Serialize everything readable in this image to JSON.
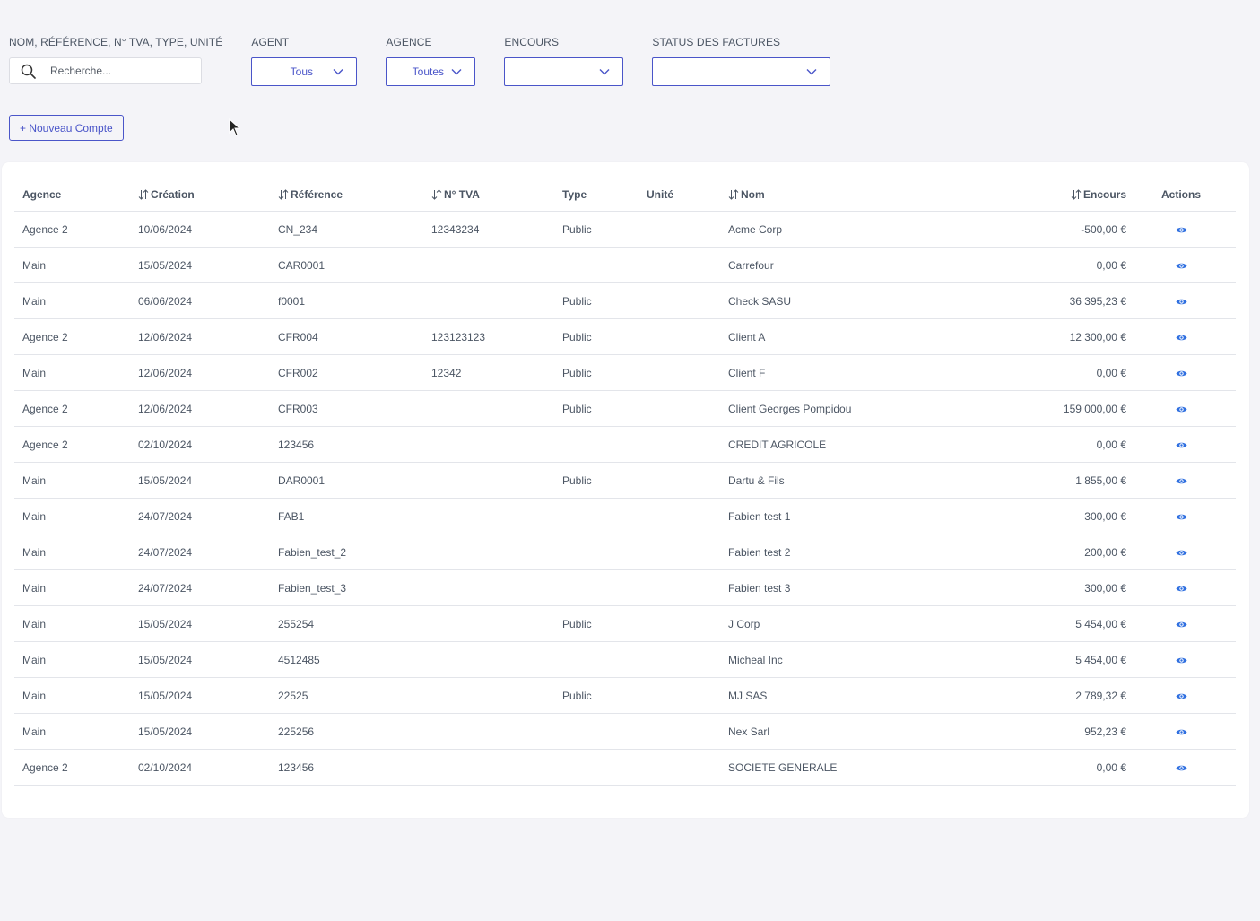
{
  "filters": {
    "search": {
      "label": "NOM, RÉFÉRENCE, N° TVA, TYPE, UNITÉ",
      "placeholder": "Recherche...",
      "value": "",
      "icon": "search-icon"
    },
    "agent": {
      "label": "AGENT",
      "value": "Tous"
    },
    "agence": {
      "label": "AGENCE",
      "value": "Toutes"
    },
    "encours": {
      "label": "ENCOURS",
      "value": ""
    },
    "status": {
      "label": "STATUS DES FACTURES",
      "value": ""
    }
  },
  "new_account_button": {
    "label": "+ Nouveau Compte"
  },
  "table": {
    "columns": {
      "agence": "Agence",
      "creation": "Création",
      "reference": "Référence",
      "tva": "N° TVA",
      "type": "Type",
      "unite": "Unité",
      "nom": "Nom",
      "encours": "Encours",
      "actions": "Actions"
    },
    "rows": [
      {
        "agence": "Agence 2",
        "creation": "10/06/2024",
        "reference": "CN_234",
        "tva": "12343234",
        "type": "Public",
        "unite": "",
        "nom": "Acme Corp",
        "encours": "-500,00 €"
      },
      {
        "agence": "Main",
        "creation": "15/05/2024",
        "reference": "CAR0001",
        "tva": "",
        "type": "",
        "unite": "",
        "nom": "Carrefour",
        "encours": "0,00 €"
      },
      {
        "agence": "Main",
        "creation": "06/06/2024",
        "reference": "f0001",
        "tva": "",
        "type": "Public",
        "unite": "",
        "nom": "Check SASU",
        "encours": "36 395,23 €"
      },
      {
        "agence": "Agence 2",
        "creation": "12/06/2024",
        "reference": "CFR004",
        "tva": "123123123",
        "type": "Public",
        "unite": "",
        "nom": "Client A",
        "encours": "12 300,00 €"
      },
      {
        "agence": "Main",
        "creation": "12/06/2024",
        "reference": "CFR002",
        "tva": "12342",
        "type": "Public",
        "unite": "",
        "nom": "Client F",
        "encours": "0,00 €"
      },
      {
        "agence": "Agence 2",
        "creation": "12/06/2024",
        "reference": "CFR003",
        "tva": "",
        "type": "Public",
        "unite": "",
        "nom": "Client Georges Pompidou",
        "encours": "159 000,00 €"
      },
      {
        "agence": "Agence 2",
        "creation": "02/10/2024",
        "reference": "123456",
        "tva": "",
        "type": "",
        "unite": "",
        "nom": "CREDIT AGRICOLE",
        "encours": "0,00 €"
      },
      {
        "agence": "Main",
        "creation": "15/05/2024",
        "reference": "DAR0001",
        "tva": "",
        "type": "Public",
        "unite": "",
        "nom": "Dartu & Fils",
        "encours": "1 855,00 €"
      },
      {
        "agence": "Main",
        "creation": "24/07/2024",
        "reference": "FAB1",
        "tva": "",
        "type": "",
        "unite": "",
        "nom": "Fabien test 1",
        "encours": "300,00 €"
      },
      {
        "agence": "Main",
        "creation": "24/07/2024",
        "reference": "Fabien_test_2",
        "tva": "",
        "type": "",
        "unite": "",
        "nom": "Fabien test 2",
        "encours": "200,00 €"
      },
      {
        "agence": "Main",
        "creation": "24/07/2024",
        "reference": "Fabien_test_3",
        "tva": "",
        "type": "",
        "unite": "",
        "nom": "Fabien test 3",
        "encours": "300,00 €"
      },
      {
        "agence": "Main",
        "creation": "15/05/2024",
        "reference": "255254",
        "tva": "",
        "type": "Public",
        "unite": "",
        "nom": "J Corp",
        "encours": "5 454,00 €"
      },
      {
        "agence": "Main",
        "creation": "15/05/2024",
        "reference": "4512485",
        "tva": "",
        "type": "",
        "unite": "",
        "nom": "Micheal Inc",
        "encours": "5 454,00 €"
      },
      {
        "agence": "Main",
        "creation": "15/05/2024",
        "reference": "22525",
        "tva": "",
        "type": "Public",
        "unite": "",
        "nom": "MJ SAS",
        "encours": "2 789,32 €"
      },
      {
        "agence": "Main",
        "creation": "15/05/2024",
        "reference": "225256",
        "tva": "",
        "type": "",
        "unite": "",
        "nom": "Nex Sarl",
        "encours": "952,23 €"
      },
      {
        "agence": "Agence 2",
        "creation": "02/10/2024",
        "reference": "123456",
        "tva": "",
        "type": "",
        "unite": "",
        "nom": "SOCIETE GENERALE",
        "encours": "0,00 €"
      }
    ],
    "row_action_icon": "eye-icon"
  },
  "colors": {
    "accent": "#4a55c9",
    "action_icon": "#2f6fe0",
    "background": "#f4f4f8"
  }
}
